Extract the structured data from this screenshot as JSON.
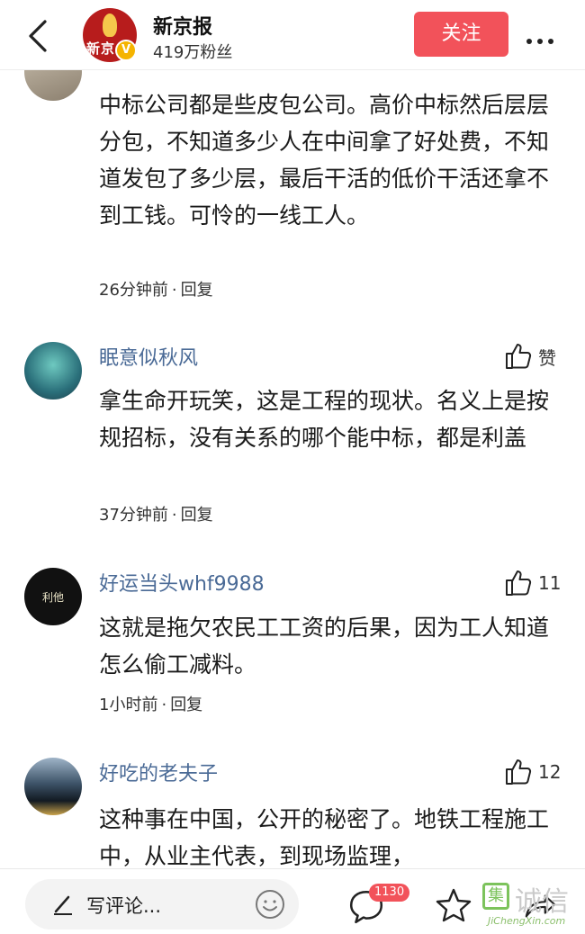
{
  "header": {
    "name": "新京报",
    "fans": "419万粉丝",
    "follow_label": "关注",
    "logo_text": "新京",
    "verified_mark": "V"
  },
  "comments": [
    {
      "user": "",
      "likes": "",
      "text": "中标公司都是些皮包公司。高价中标然后层层分包，不知道多少人在中间拿了好处费，不知道发包了多少层，最后干活的低价干活还拿不到工钱。可怜的一线工人。",
      "time": "26分钟前",
      "reply": "回复"
    },
    {
      "user": "眠意似秋风",
      "likes": "赞",
      "text": "拿生命开玩笑，这是工程的现状。名义上是按规招标，没有关系的哪个能中标，都是利盖",
      "time": "37分钟前",
      "reply": "回复"
    },
    {
      "user": "好运当头whf9988",
      "likes": "11",
      "text": "这就是拖欠农民工工资的后果，因为工人知道怎么偷工减料。",
      "time": "1小时前",
      "reply": "回复",
      "avatar_text": "利他"
    },
    {
      "user": "好吃的老夫子",
      "likes": "12",
      "text": "这种事在中国，公开的秘密了。地铁工程施工中，从业主代表，到现场监理，",
      "time": "",
      "reply": ""
    }
  ],
  "bottom": {
    "placeholder": "写评论...",
    "comment_count": "1130",
    "watermark_char": "集",
    "watermark_text": "诚信",
    "watermark_url": "JiChengXin.com"
  },
  "colors": {
    "accent": "#f2525a",
    "username": "#4a6a96",
    "logo_red": "#b71c1c"
  },
  "icons": [
    "back-arrow-icon",
    "more-dots-icon",
    "thumb-up-icon",
    "pen-icon",
    "emoji-icon",
    "comment-bubble-icon",
    "star-icon",
    "share-icon"
  ]
}
